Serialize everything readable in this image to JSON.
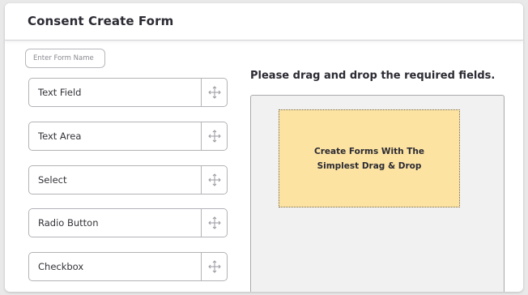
{
  "header": {
    "title": "Consent Create Form"
  },
  "form_name": {
    "placeholder": "Enter Form Name",
    "value": ""
  },
  "fields": [
    {
      "label": "Text Field",
      "icon": "move-icon"
    },
    {
      "label": "Text Area",
      "icon": "move-icon"
    },
    {
      "label": "Select",
      "icon": "move-icon"
    },
    {
      "label": "Radio Button",
      "icon": "move-icon"
    },
    {
      "label": "Checkbox",
      "icon": "move-icon"
    }
  ],
  "canvas": {
    "instructions": "Please drag and drop the required fields.",
    "placeholder_text": "Create Forms With The\nSimplest Drag & Drop"
  },
  "colors": {
    "placeholder_fill": "#fde3a2",
    "drop_area": "#f1f1f2",
    "text": "#2b2b33"
  }
}
